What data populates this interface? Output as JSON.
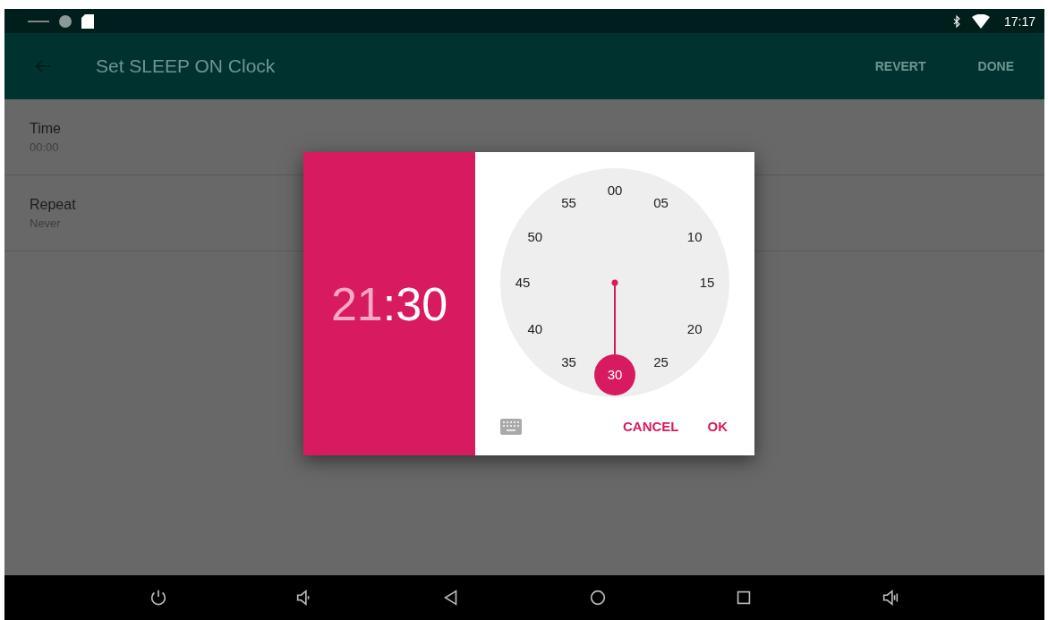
{
  "status_bar": {
    "time": "17:17"
  },
  "toolbar": {
    "title": "Set SLEEP ON Clock",
    "actions": [
      "REVERT",
      "DONE"
    ]
  },
  "settings": [
    {
      "title": "Time",
      "value": "00:00"
    },
    {
      "title": "Repeat",
      "value": "Never"
    }
  ],
  "dialog": {
    "header": [
      {
        "kind": "field",
        "text": "21",
        "selected": false
      },
      {
        "kind": "separator",
        "text": ":"
      },
      {
        "kind": "field",
        "text": "30",
        "selected": true
      }
    ],
    "dial": [
      {
        "label": "00",
        "selected": false
      },
      {
        "label": "05",
        "selected": false
      },
      {
        "label": "10",
        "selected": false
      },
      {
        "label": "15",
        "selected": false
      },
      {
        "label": "20",
        "selected": false
      },
      {
        "label": "25",
        "selected": false
      },
      {
        "label": "30",
        "selected": true
      },
      {
        "label": "35",
        "selected": false
      },
      {
        "label": "40",
        "selected": false
      },
      {
        "label": "45",
        "selected": false
      },
      {
        "label": "50",
        "selected": false
      },
      {
        "label": "55",
        "selected": false
      }
    ],
    "buttons": [
      "CANCEL",
      "OK"
    ]
  }
}
